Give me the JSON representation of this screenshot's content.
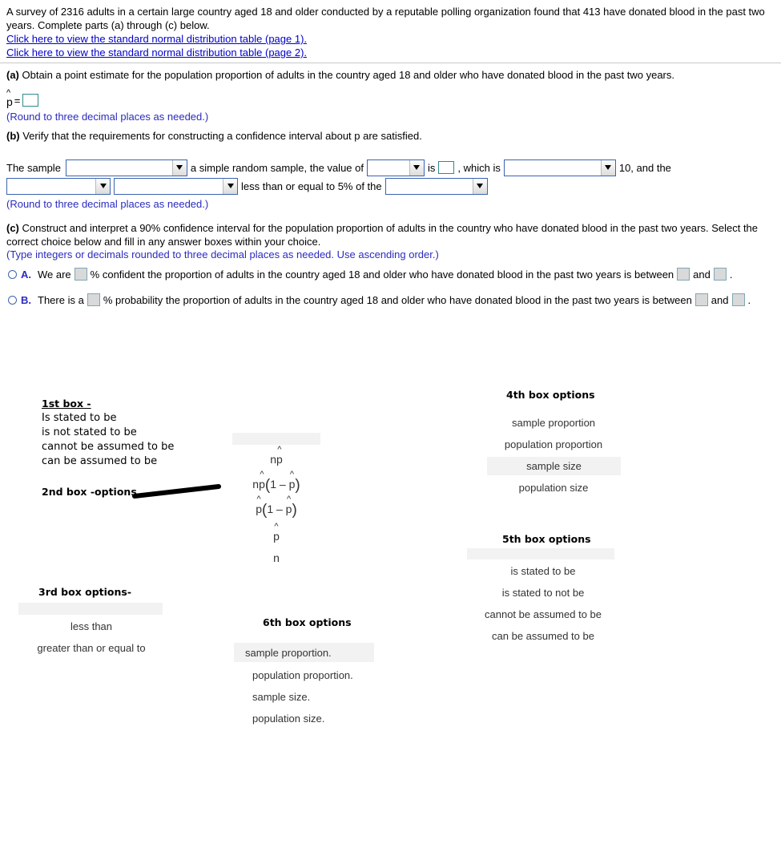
{
  "problem": {
    "stem": "A survey of 2316 adults in a certain large country aged 18 and older conducted by a reputable polling organization found that 413 have donated blood in the past two years. Complete parts (a) through (c) below.",
    "links": [
      "Click here to view the standard normal distribution table (page 1).",
      "Click here to view the standard normal distribution table (page 2)."
    ]
  },
  "part_a": {
    "label": "(a)",
    "prompt": " Obtain a point estimate for the population proportion of adults in the country aged 18 and older who have donated blood in the past two years.",
    "phat_symbol": "p",
    "hat": "^",
    "equals": "=",
    "input_value": "",
    "note": "(Round to three decimal places as needed.)"
  },
  "part_b": {
    "label": "(b)",
    "prompt": " Verify that the requirements for constructing a confidence interval about p are satisfied.",
    "line1": {
      "text_start": "The sample",
      "dropdown1_value": "",
      "text_after_dd1": "a simple random sample, the value of",
      "dropdown2_value": "",
      "text_is": "is",
      "inline_input_value": "",
      "text_which_is": ", which is",
      "dropdown3_value": "",
      "text_ten": "10, and the"
    },
    "line2": {
      "dropdown4_value": "",
      "dropdown5_value": "",
      "text_middle": "less than or equal to 5% of the",
      "dropdown6_value": ""
    },
    "note": "(Round to three decimal places as needed.)"
  },
  "part_c": {
    "label": "(c)",
    "prompt": " Construct and interpret a 90% confidence interval for the population proportion of adults in the country who have donated blood in the past two years. Select the correct choice below and fill in any answer boxes within your choice.",
    "note": "(Type integers or decimals rounded to three decimal places as needed. Use ascending order.)",
    "choices": [
      {
        "letter": "A.",
        "text_1": "We are",
        "box_1": "",
        "text_2": "% confident the proportion of adults in the country aged 18 and older who have donated blood in the past two years is between",
        "box_2": "",
        "text_3": "and",
        "box_3": "",
        "text_4": "."
      },
      {
        "letter": "B.",
        "text_1": "There is a",
        "box_1": "",
        "text_2": "% probability the proportion of adults in the country aged 18 and older who have donated blood in the past two years is between",
        "box_2": "",
        "text_3": "and",
        "box_3": "",
        "text_4": "."
      }
    ]
  },
  "annotations": {
    "box1": {
      "title": "1st box -",
      "options": [
        "Is stated to be",
        "is not stated to be",
        "cannot be assumed to be",
        "can be assumed to be"
      ]
    },
    "box2": {
      "title_bold": "2nd box -",
      "title_rest": "options",
      "highlighted": "",
      "options": [
        "n p̂",
        "n p̂(1 − p̂)",
        "p̂(1 − p̂)",
        "p̂",
        "n"
      ]
    },
    "box3": {
      "title": "3rd box options-",
      "highlighted": "",
      "options": [
        "less than",
        "greater than or equal to"
      ]
    },
    "box4": {
      "title": "4th box options",
      "highlighted": "sample size",
      "options": [
        "sample proportion",
        "population proportion",
        "sample size",
        "population size"
      ]
    },
    "box5": {
      "title": "5th box options",
      "highlighted": "",
      "options": [
        "is stated to be",
        "is stated to not be",
        "cannot be assumed to be",
        "can be assumed to be"
      ]
    },
    "box6": {
      "title": "6th box options",
      "highlighted": "sample proportion.",
      "options": [
        "sample proportion.",
        "population proportion.",
        "sample size.",
        "population size."
      ]
    }
  }
}
